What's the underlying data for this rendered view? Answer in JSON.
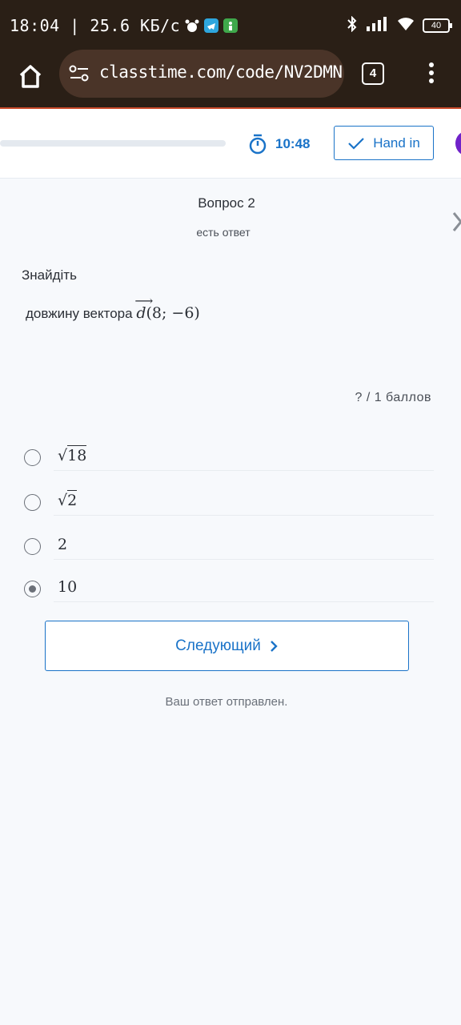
{
  "status_bar": {
    "left_text": "18:04 | 25.6 КБ/с",
    "battery": "40"
  },
  "browser": {
    "url": "classtime.com/code/NV2DMN",
    "tab_count": "4"
  },
  "header": {
    "timer": "10:48",
    "hand_in_label": "Hand in",
    "accent_color": "#1a73c8"
  },
  "question": {
    "title": "Вопрос 2",
    "status": "есть ответ",
    "prompt": "Знайдіть",
    "text": "довжину вектора",
    "vector_name": "d",
    "vector_coords": "(8; −6)",
    "score": "?  /  1  баллов"
  },
  "options": [
    {
      "radical": "√",
      "value": "18",
      "selected": false
    },
    {
      "radical": "√",
      "value": "2",
      "selected": false
    },
    {
      "radical": "",
      "value": "2",
      "selected": false
    },
    {
      "radical": "",
      "value": "10",
      "selected": true
    }
  ],
  "footer": {
    "next_label": "Следующий",
    "sent_message": "Ваш ответ отправлен."
  }
}
